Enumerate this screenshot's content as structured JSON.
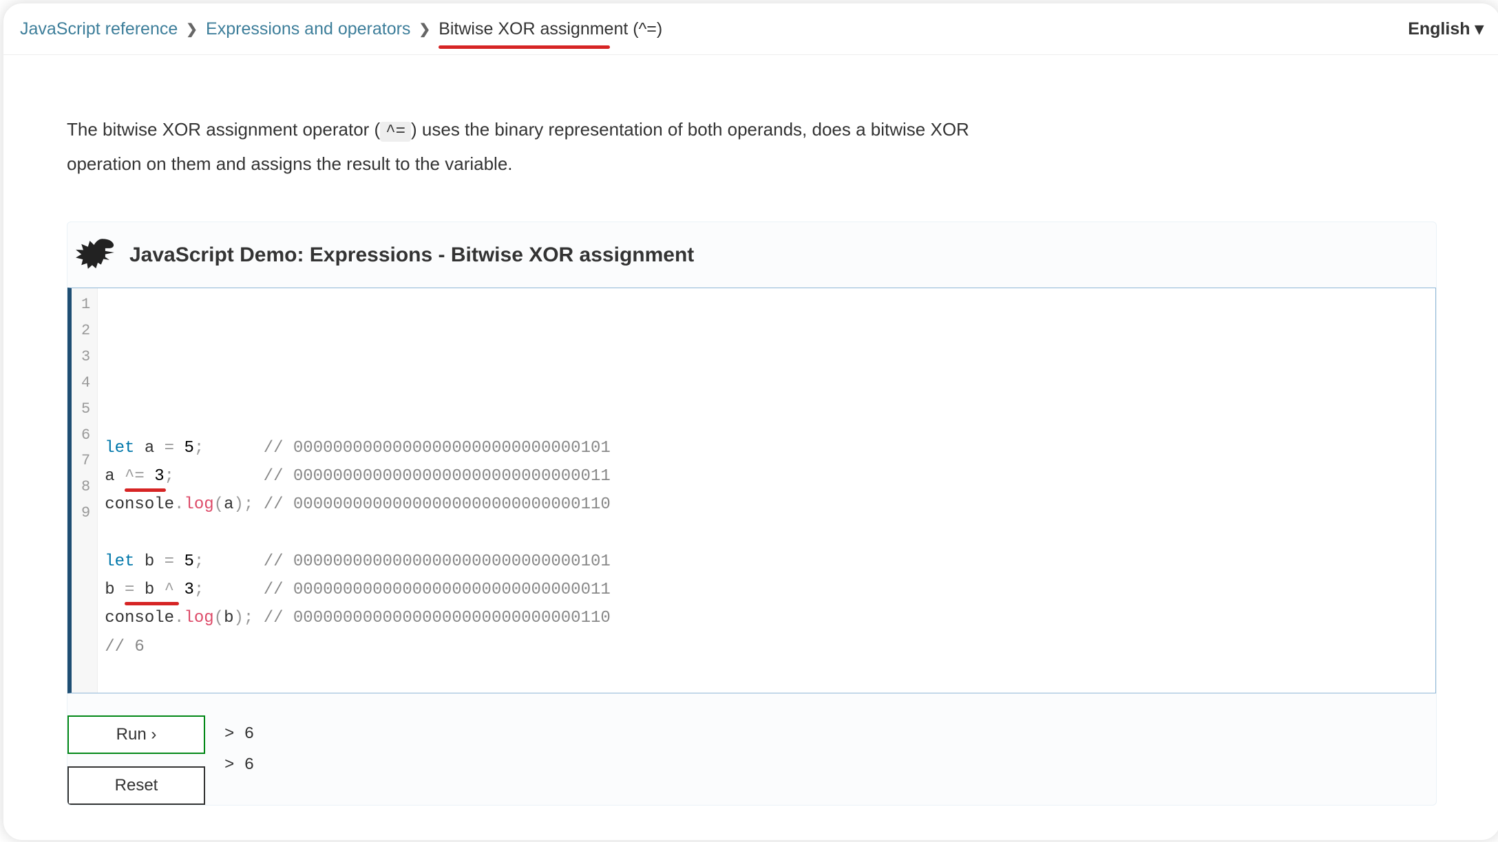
{
  "breadcrumb": {
    "items": [
      {
        "label": "JavaScript reference",
        "link": true
      },
      {
        "label": "Expressions and operators",
        "link": true
      },
      {
        "label": "Bitwise XOR assignment (^=)",
        "link": false,
        "current": true
      }
    ],
    "language": "English ▾"
  },
  "intro": {
    "pre": "The bitwise XOR assignment operator (",
    "chip": "^=",
    "post": ") uses the binary representation of both operands, does a bitwise XOR operation on them and assigns the result to the variable."
  },
  "demo": {
    "title": "JavaScript Demo: Expressions - Bitwise XOR assignment",
    "code_raw": "let a = 5;      // 00000000000000000000000000000101\na ^= 3;         // 00000000000000000000000000000011\nconsole.log(a); // 00000000000000000000000000000110\n\nlet b = 5;      // 00000000000000000000000000000101\nb = b ^ 3;      // 00000000000000000000000000000011\nconsole.log(b); // 00000000000000000000000000000110\n// 6",
    "lines": [
      {
        "n": 1,
        "tokens": [
          [
            "kw",
            "let"
          ],
          [
            "name",
            " a "
          ],
          [
            "punc",
            "="
          ],
          [
            "numb",
            " 5"
          ],
          [
            "punc",
            ";      "
          ],
          [
            "com",
            "// 00000000000000000000000000000101"
          ]
        ]
      },
      {
        "n": 2,
        "tokens": [
          [
            "name",
            "a "
          ],
          [
            "punc",
            "^="
          ],
          [
            "numb",
            " 3"
          ],
          [
            "punc",
            ";         "
          ],
          [
            "com",
            "// 00000000000000000000000000000011"
          ]
        ]
      },
      {
        "n": 3,
        "tokens": [
          [
            "name",
            "console"
          ],
          [
            "punc",
            "."
          ],
          [
            "fn",
            "log"
          ],
          [
            "punc",
            "("
          ],
          [
            "name",
            "a"
          ],
          [
            "punc",
            ");"
          ],
          [
            "name",
            " "
          ],
          [
            "com",
            "// 00000000000000000000000000000110"
          ]
        ]
      },
      {
        "n": 4,
        "tokens": [
          [
            "name",
            ""
          ]
        ]
      },
      {
        "n": 5,
        "tokens": [
          [
            "kw",
            "let"
          ],
          [
            "name",
            " b "
          ],
          [
            "punc",
            "="
          ],
          [
            "numb",
            " 5"
          ],
          [
            "punc",
            ";      "
          ],
          [
            "com",
            "// 00000000000000000000000000000101"
          ]
        ]
      },
      {
        "n": 6,
        "tokens": [
          [
            "name",
            "b "
          ],
          [
            "punc",
            "="
          ],
          [
            "name",
            " b "
          ],
          [
            "punc",
            "^"
          ],
          [
            "numb",
            " 3"
          ],
          [
            "punc",
            ";      "
          ],
          [
            "com",
            "// 00000000000000000000000000000011"
          ]
        ]
      },
      {
        "n": 7,
        "tokens": [
          [
            "name",
            "console"
          ],
          [
            "punc",
            "."
          ],
          [
            "fn",
            "log"
          ],
          [
            "punc",
            "("
          ],
          [
            "name",
            "b"
          ],
          [
            "punc",
            ");"
          ],
          [
            "name",
            " "
          ],
          [
            "com",
            "// 00000000000000000000000000000110"
          ]
        ]
      },
      {
        "n": 8,
        "tokens": [
          [
            "com",
            "// 6"
          ]
        ]
      },
      {
        "n": 9,
        "tokens": [
          [
            "name",
            ""
          ]
        ]
      }
    ],
    "buttons": {
      "run": "Run ›",
      "reset": "Reset"
    },
    "output": [
      "> 6",
      "> 6"
    ]
  },
  "annotations": {
    "red_underlines": [
      {
        "target": "breadcrumb-current"
      },
      {
        "target": "code-line-2",
        "text": "^= 3"
      },
      {
        "target": "code-line-6",
        "text": "= b ^"
      }
    ]
  }
}
